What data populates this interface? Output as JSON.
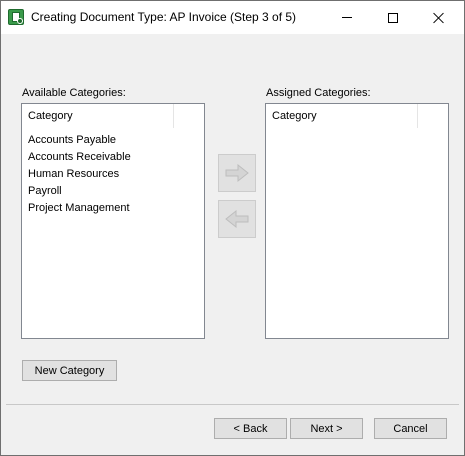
{
  "window": {
    "title": "Creating Document Type: AP Invoice (Step 3 of 5)"
  },
  "available": {
    "label": "Available Categories:",
    "column_header": "Category",
    "items": [
      "Accounts Payable",
      "Accounts Receivable",
      "Human Resources",
      "Payroll",
      "Project Management"
    ]
  },
  "assigned": {
    "label": "Assigned Categories:",
    "column_header": "Category",
    "items": []
  },
  "buttons": {
    "new_category": "New Category",
    "back": "< Back",
    "next": "Next >",
    "cancel": "Cancel"
  },
  "icons": {
    "move_right": "right-arrow-icon",
    "move_left": "left-arrow-icon",
    "app": "document-type-app-icon"
  },
  "colors": {
    "dialog_bg": "#f0f0f0",
    "button_bg": "#e1e1e1",
    "arrow_disabled": "#d4d4d4"
  }
}
